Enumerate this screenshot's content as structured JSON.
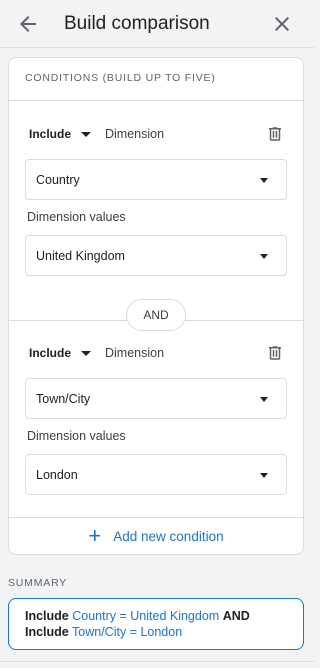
{
  "header": {
    "title": "Build comparison",
    "back_icon": "arrow-back-icon",
    "close_icon": "close-icon"
  },
  "conditions_card": {
    "heading": "CONDITIONS (BUILD UP TO FIVE)",
    "conditions": [
      {
        "mode": "Include",
        "dimension_label": "Dimension",
        "dimension_value": "Country",
        "values_label": "Dimension values",
        "values_value": "United Kingdom"
      },
      {
        "mode": "Include",
        "dimension_label": "Dimension",
        "dimension_value": "Town/City",
        "values_label": "Dimension values",
        "values_value": "London"
      }
    ],
    "and_label": "AND",
    "add_condition_label": "Add new condition"
  },
  "summary": {
    "label": "SUMMARY",
    "line1_include": "Include",
    "line1_condition": "Country = United Kingdom",
    "line1_joiner": "AND",
    "line2_include": "Include",
    "line2_condition": "Town/City = London"
  },
  "colors": {
    "accent": "#1a73e8",
    "border": "#dadce0",
    "background": "#f1f3f4"
  }
}
